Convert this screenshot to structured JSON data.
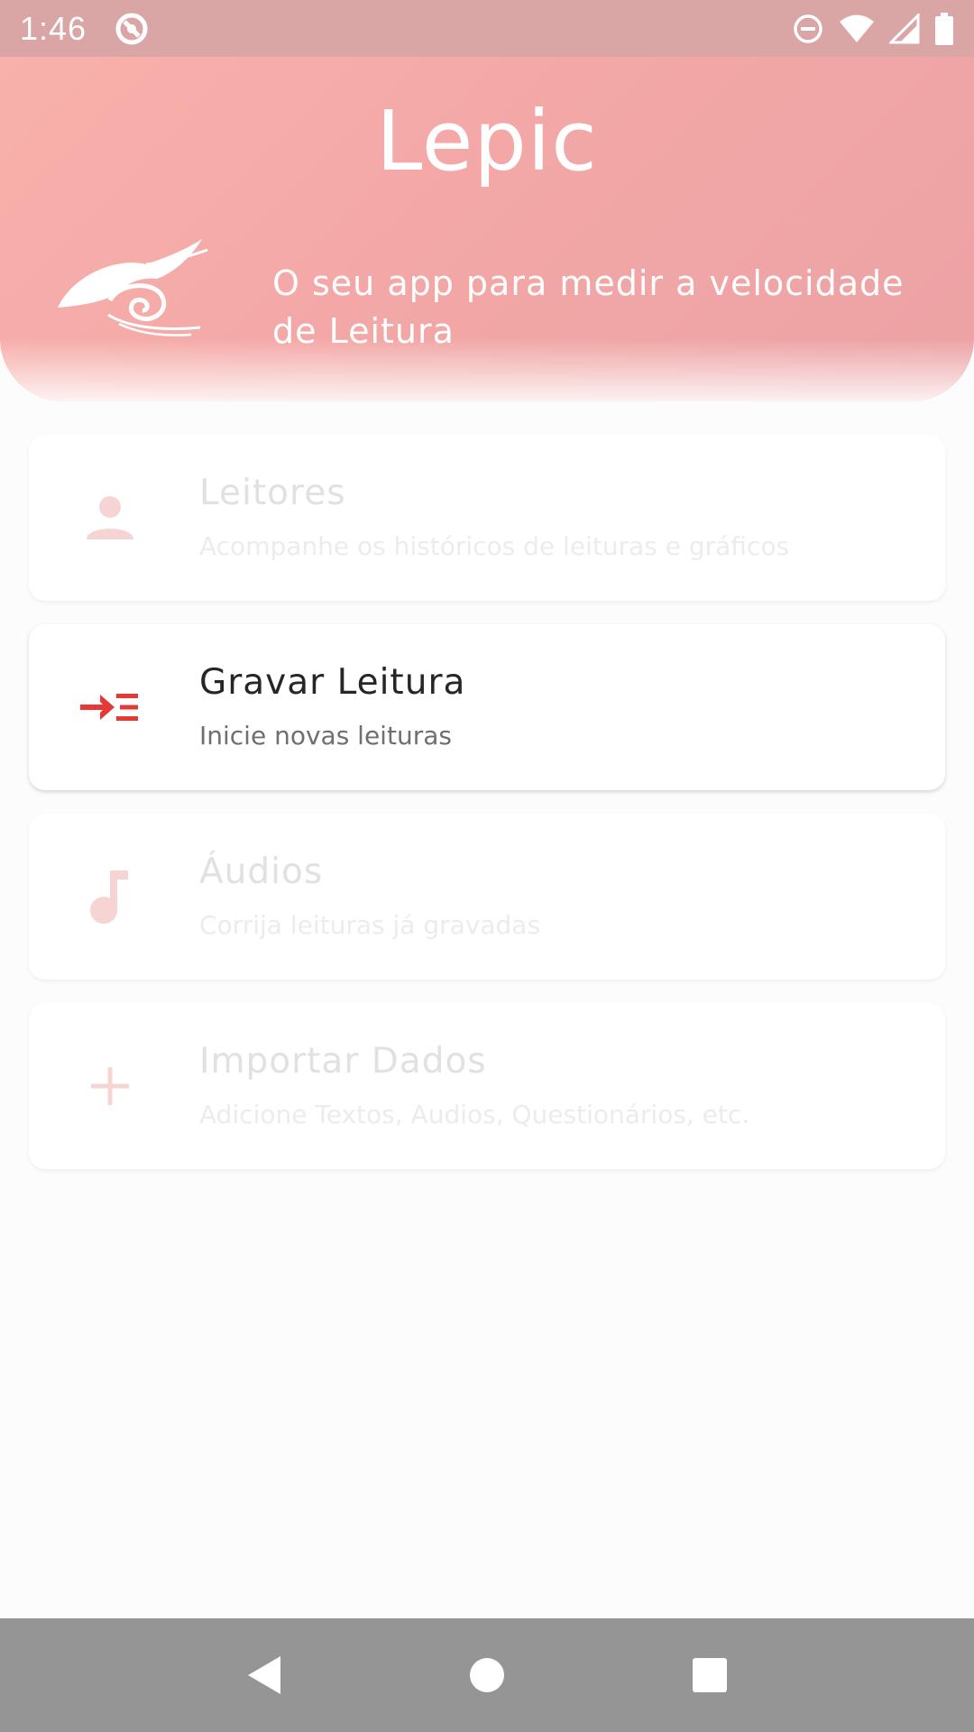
{
  "status_bar": {
    "time": "1:46",
    "icons": [
      "no-sim-circle-icon",
      "do-not-disturb-icon",
      "wifi-icon",
      "signal-icon",
      "battery-icon"
    ]
  },
  "header": {
    "title": "Lepic",
    "tagline": "O seu app para medir a velocidade de Leitura",
    "logo": "snail-wave-logo"
  },
  "menu": [
    {
      "title": "Leitores",
      "subtitle": "Acompanhe os históricos de leituras e gráficos",
      "icon": "person-icon",
      "enabled": false
    },
    {
      "title": "Gravar Leitura",
      "subtitle": "Inicie novas leituras",
      "icon": "record-list-icon",
      "enabled": true
    },
    {
      "title": "Áudios",
      "subtitle": "Corrija leituras já gravadas",
      "icon": "music-note-icon",
      "enabled": false
    },
    {
      "title": "Importar Dados",
      "subtitle": "Adicione Textos, Audios, Questionários, etc.",
      "icon": "plus-icon",
      "enabled": false
    }
  ],
  "nav_bar": {
    "icons": [
      "back-icon",
      "home-icon",
      "recents-icon"
    ]
  },
  "colors": {
    "accent": "#e53935",
    "accent_faded": "#f7d4d4",
    "header_start": "#f9b1ab",
    "header_end": "#eca1a4",
    "status_bar": "#d9a5a5",
    "nav_bar": "#959595"
  }
}
